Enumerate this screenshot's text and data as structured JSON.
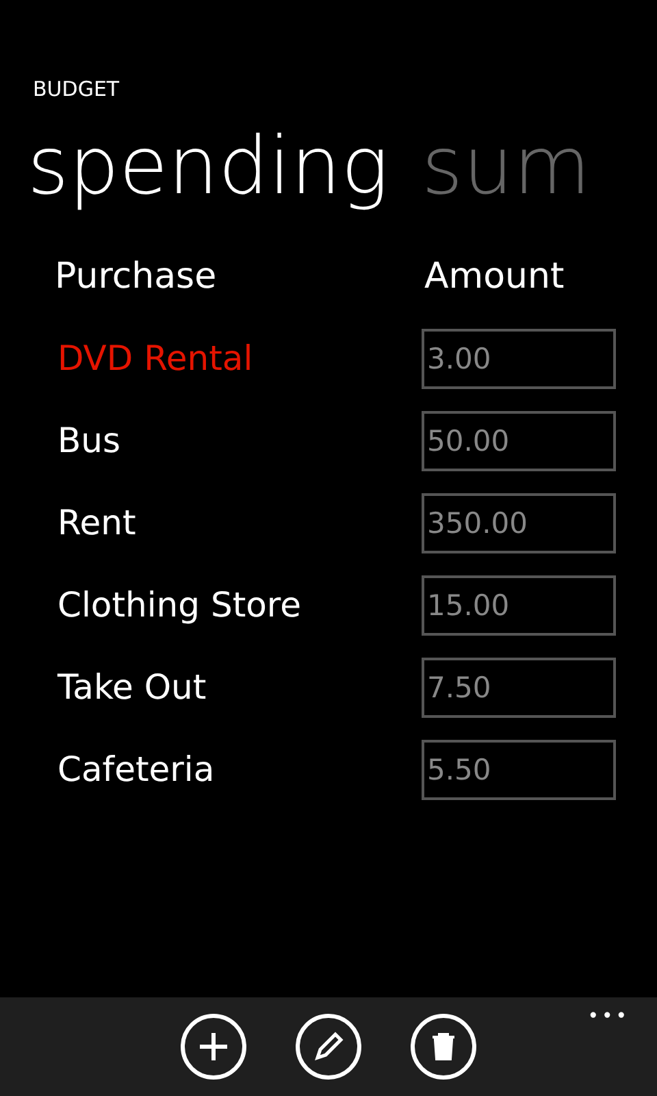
{
  "app_title": "BUDGET",
  "pivot": [
    {
      "label": "spending",
      "selected": true
    },
    {
      "label": "sum",
      "selected": false
    }
  ],
  "table": {
    "columns": [
      "Purchase",
      "Amount"
    ],
    "rows": [
      {
        "purchase": "DVD Rental",
        "amount": "3.00",
        "selected": true
      },
      {
        "purchase": "Bus",
        "amount": "50.00",
        "selected": false
      },
      {
        "purchase": "Rent",
        "amount": "350.00",
        "selected": false
      },
      {
        "purchase": "Clothing Store",
        "amount": "15.00",
        "selected": false
      },
      {
        "purchase": "Take Out",
        "amount": "7.50",
        "selected": false
      },
      {
        "purchase": "Cafeteria",
        "amount": "5.50",
        "selected": false
      }
    ]
  },
  "app_bar": {
    "buttons": [
      {
        "kind": "add"
      },
      {
        "kind": "edit"
      },
      {
        "kind": "delete"
      }
    ],
    "more": "•••"
  }
}
